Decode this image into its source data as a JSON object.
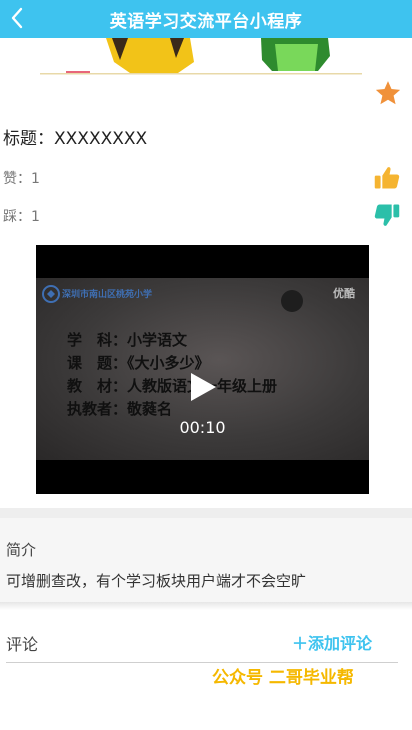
{
  "navbar": {
    "title": "英语学习交流平台小程序"
  },
  "post": {
    "title_label": "标题：",
    "title_value": "XXXXXXXX",
    "like_label": "赞：",
    "like_count": "1",
    "dislike_label": "踩：",
    "dislike_count": "1"
  },
  "video": {
    "school_name": "深圳市南山区桃苑小学",
    "corner_mark": "优酷",
    "lines": [
      "学　科：小学语文",
      "课　题：《大小多少》",
      "教　材：人教版语文一年级上册",
      "执教者：敬蕤名"
    ],
    "current_time": "00:10"
  },
  "intro": {
    "label": "简介",
    "text": "可增删查改，有个学习板块用户端才不会空旷"
  },
  "comments": {
    "label": "评论",
    "add_label": "＋添加评论"
  },
  "watermark": "公众号 二哥毕业帮",
  "colors": {
    "navbar": "#3ec3ef",
    "accent": "#3ec3ef",
    "star": "#f0913a",
    "thumb_up": "#f5b431",
    "thumb_down": "#2bbfa9",
    "watermark": "#f5b800"
  },
  "icons": {
    "back": "back-arrow-icon",
    "favorite": "star-icon",
    "like": "thumbs-up-icon",
    "dislike": "thumbs-down-icon",
    "play": "play-icon"
  }
}
